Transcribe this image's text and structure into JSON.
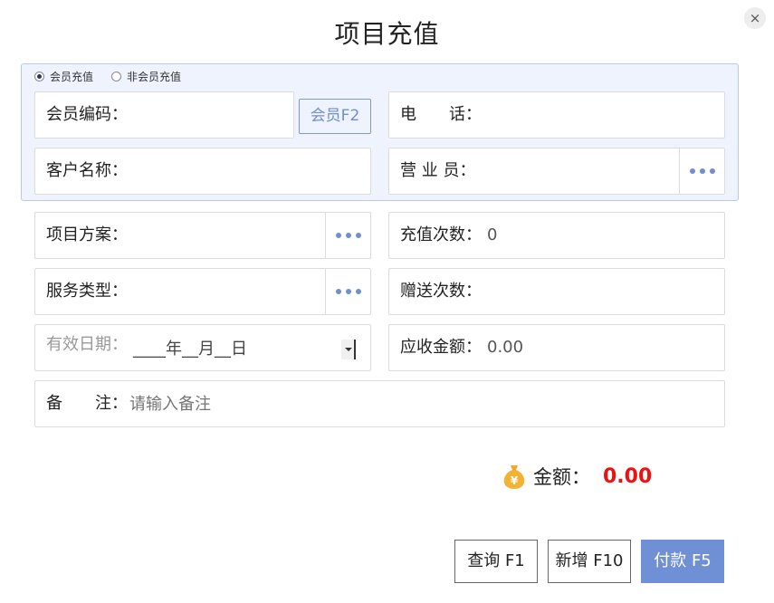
{
  "dialog": {
    "title": "项目充值",
    "close_icon": "×"
  },
  "recharge_type": {
    "options": [
      {
        "label": "会员充值",
        "checked": true
      },
      {
        "label": "非会员充值",
        "checked": false
      }
    ]
  },
  "member": {
    "code_label": "会员编码：",
    "code_value": "",
    "member_button": "会员F2",
    "phone_label": "电　　话：",
    "phone_value": "",
    "customer_label": "客户名称：",
    "customer_value": "",
    "sales_label": "营  业 员：",
    "sales_value": ""
  },
  "form": {
    "plan_label": "项目方案：",
    "plan_value": "",
    "recharge_count_label": "充值次数：",
    "recharge_count_value": "0",
    "service_label": "服务类型：",
    "service_value": "",
    "gift_count_label": "赠送次数：",
    "gift_count_value": "",
    "valid_date_label": "有效日期：",
    "valid_date_value": "____年__月__日",
    "receivable_label": "应收金额：",
    "receivable_value": "0.00",
    "remark_label": "备　　注：",
    "remark_placeholder": "请输入备注"
  },
  "total": {
    "label": "金额：",
    "value": "0.00",
    "icon": "moneybag-icon",
    "value_color": "#ee1111"
  },
  "buttons": {
    "query": "查询 F1",
    "add": "新增 F10",
    "pay": "付款 F5"
  },
  "colors": {
    "accent": "#7090d6",
    "panel_bg": "#eef3fd"
  }
}
